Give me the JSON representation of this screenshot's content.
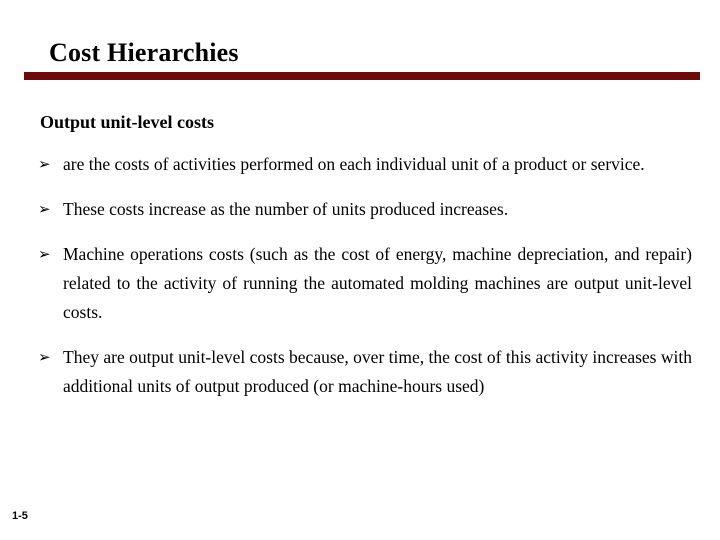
{
  "slide": {
    "title": "Cost Hierarchies",
    "accent_color": "#6E0A0A",
    "background_color": "#FFFFFF",
    "text_color": "#000000",
    "subheading": "Output unit-level costs",
    "bullet_marker": "➢",
    "bullets": [
      {
        "marker": "➢",
        "text": "are the costs of activities performed on each individual unit of a product or service."
      },
      {
        "marker": "➢",
        "text": "These costs increase as the number of units produced increases."
      },
      {
        "marker": "➢",
        "text": "Machine operations costs (such as the cost of energy, machine depreciation, and repair) related to the activity of running the automated molding machines are output unit-level costs."
      },
      {
        "marker": "➢",
        "text": "They are output unit-level costs because, over time, the cost of this activity increases with additional units of output produced (or machine-hours used)"
      }
    ],
    "slide_number": "1-5"
  }
}
